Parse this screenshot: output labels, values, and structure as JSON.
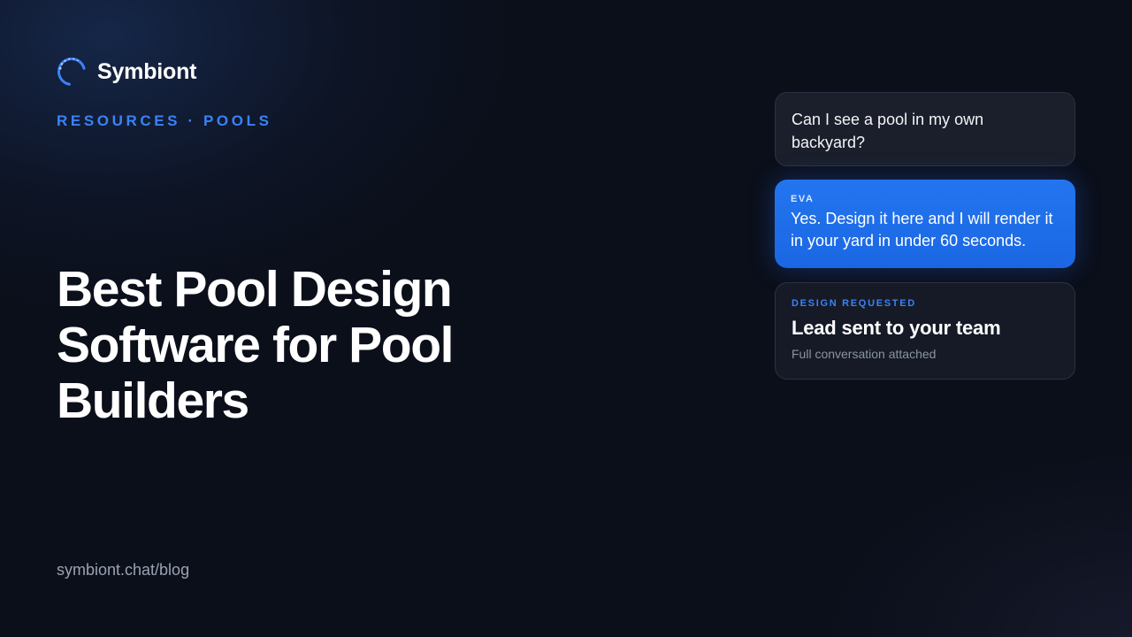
{
  "brand": {
    "name": "Symbiont",
    "logo_icon": "spinner-ring-icon",
    "accent_color": "#3b82f6"
  },
  "eyebrow": "RESOURCES · POOLS",
  "headline": "Best Pool Design Software for Pool Builders",
  "footer": {
    "url": "symbiont.chat/blog"
  },
  "chat": {
    "user_message": "Can I see a pool in my own backyard?",
    "assistant": {
      "label": "EVA",
      "message": "Yes. Design it here and I will render it in your yard in under 60 seconds."
    },
    "lead_card": {
      "label": "DESIGN REQUESTED",
      "title": "Lead sent to your team",
      "subtitle": "Full conversation attached"
    }
  }
}
